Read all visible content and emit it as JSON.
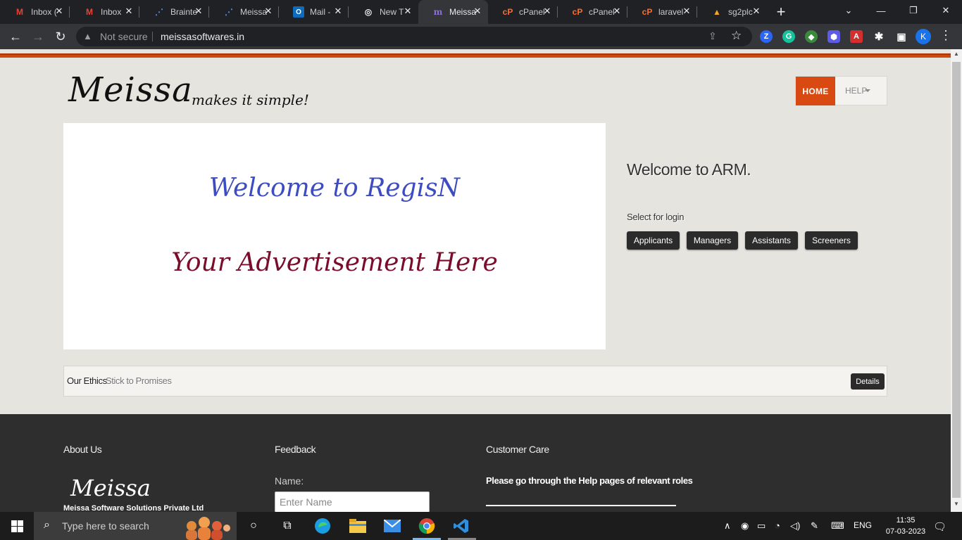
{
  "browser": {
    "tabs": [
      {
        "label": "Inbox (",
        "icon": "gmail-icon"
      },
      {
        "label": "Inbox",
        "icon": "gmail-icon"
      },
      {
        "label": "Brainte",
        "icon": "braintree-icon"
      },
      {
        "label": "Meissa",
        "icon": "braintree-icon"
      },
      {
        "label": "Mail -",
        "icon": "outlook-icon"
      },
      {
        "label": "New T",
        "icon": "chrome-icon"
      },
      {
        "label": "Meissa",
        "icon": "meissa-icon"
      },
      {
        "label": "cPanel",
        "icon": "cpanel-icon"
      },
      {
        "label": "cPanel",
        "icon": "cpanel-icon"
      },
      {
        "label": "laravel",
        "icon": "cpanel-icon"
      },
      {
        "label": "sg2plc",
        "icon": "sg2plc-icon"
      }
    ],
    "active_tab_index": 6,
    "security_label": "Not secure",
    "url": "meissasoftwares.in",
    "profile_initial": "K"
  },
  "page": {
    "brand": "Meissa",
    "tagline": "makes it simple!",
    "nav": {
      "home": "HOME",
      "help": "HELP"
    },
    "ad": {
      "welcome": "Welcome to RegisN",
      "promo": "Your Advertisement Here"
    },
    "login": {
      "title": "Welcome to ARM.",
      "prompt": "Select for login",
      "buttons": [
        "Applicants",
        "Managers",
        "Assistants",
        "Screeners"
      ]
    },
    "ethics": {
      "label": "Our Ethics",
      "motto": "Stick to Promises",
      "button": "Details"
    },
    "footer": {
      "about_heading": "About Us",
      "feedback_heading": "Feedback",
      "care_heading": "Customer Care",
      "logo": "Meissa",
      "company": "Meissa Software Solutions Private Ltd",
      "name_label": "Name:",
      "name_placeholder": "Enter Name",
      "care_text": "Please go through the Help pages of relevant roles"
    },
    "colors": {
      "accent": "#d94a12",
      "ad_welcome": "#3d4cc0",
      "ad_promo": "#7a0d2b"
    }
  },
  "taskbar": {
    "search_placeholder": "Type here to search",
    "language": "ENG",
    "time": "11:35",
    "date": "07-03-2023"
  }
}
